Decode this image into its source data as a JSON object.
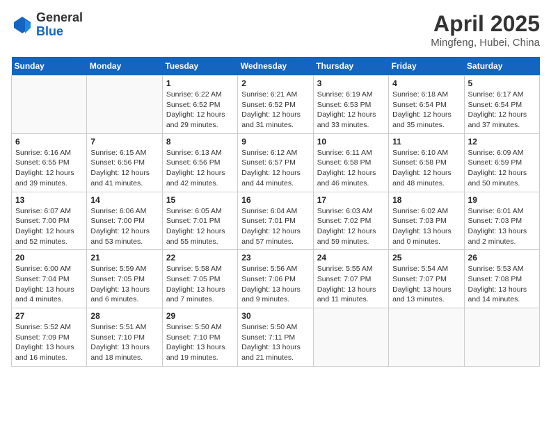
{
  "header": {
    "logo": {
      "line1": "General",
      "line2": "Blue"
    },
    "title": "April 2025",
    "subtitle": "Mingfeng, Hubei, China"
  },
  "weekdays": [
    "Sunday",
    "Monday",
    "Tuesday",
    "Wednesday",
    "Thursday",
    "Friday",
    "Saturday"
  ],
  "weeks": [
    [
      {
        "day": null
      },
      {
        "day": null
      },
      {
        "day": "1",
        "sunrise": "Sunrise: 6:22 AM",
        "sunset": "Sunset: 6:52 PM",
        "daylight": "Daylight: 12 hours and 29 minutes."
      },
      {
        "day": "2",
        "sunrise": "Sunrise: 6:21 AM",
        "sunset": "Sunset: 6:52 PM",
        "daylight": "Daylight: 12 hours and 31 minutes."
      },
      {
        "day": "3",
        "sunrise": "Sunrise: 6:19 AM",
        "sunset": "Sunset: 6:53 PM",
        "daylight": "Daylight: 12 hours and 33 minutes."
      },
      {
        "day": "4",
        "sunrise": "Sunrise: 6:18 AM",
        "sunset": "Sunset: 6:54 PM",
        "daylight": "Daylight: 12 hours and 35 minutes."
      },
      {
        "day": "5",
        "sunrise": "Sunrise: 6:17 AM",
        "sunset": "Sunset: 6:54 PM",
        "daylight": "Daylight: 12 hours and 37 minutes."
      }
    ],
    [
      {
        "day": "6",
        "sunrise": "Sunrise: 6:16 AM",
        "sunset": "Sunset: 6:55 PM",
        "daylight": "Daylight: 12 hours and 39 minutes."
      },
      {
        "day": "7",
        "sunrise": "Sunrise: 6:15 AM",
        "sunset": "Sunset: 6:56 PM",
        "daylight": "Daylight: 12 hours and 41 minutes."
      },
      {
        "day": "8",
        "sunrise": "Sunrise: 6:13 AM",
        "sunset": "Sunset: 6:56 PM",
        "daylight": "Daylight: 12 hours and 42 minutes."
      },
      {
        "day": "9",
        "sunrise": "Sunrise: 6:12 AM",
        "sunset": "Sunset: 6:57 PM",
        "daylight": "Daylight: 12 hours and 44 minutes."
      },
      {
        "day": "10",
        "sunrise": "Sunrise: 6:11 AM",
        "sunset": "Sunset: 6:58 PM",
        "daylight": "Daylight: 12 hours and 46 minutes."
      },
      {
        "day": "11",
        "sunrise": "Sunrise: 6:10 AM",
        "sunset": "Sunset: 6:58 PM",
        "daylight": "Daylight: 12 hours and 48 minutes."
      },
      {
        "day": "12",
        "sunrise": "Sunrise: 6:09 AM",
        "sunset": "Sunset: 6:59 PM",
        "daylight": "Daylight: 12 hours and 50 minutes."
      }
    ],
    [
      {
        "day": "13",
        "sunrise": "Sunrise: 6:07 AM",
        "sunset": "Sunset: 7:00 PM",
        "daylight": "Daylight: 12 hours and 52 minutes."
      },
      {
        "day": "14",
        "sunrise": "Sunrise: 6:06 AM",
        "sunset": "Sunset: 7:00 PM",
        "daylight": "Daylight: 12 hours and 53 minutes."
      },
      {
        "day": "15",
        "sunrise": "Sunrise: 6:05 AM",
        "sunset": "Sunset: 7:01 PM",
        "daylight": "Daylight: 12 hours and 55 minutes."
      },
      {
        "day": "16",
        "sunrise": "Sunrise: 6:04 AM",
        "sunset": "Sunset: 7:01 PM",
        "daylight": "Daylight: 12 hours and 57 minutes."
      },
      {
        "day": "17",
        "sunrise": "Sunrise: 6:03 AM",
        "sunset": "Sunset: 7:02 PM",
        "daylight": "Daylight: 12 hours and 59 minutes."
      },
      {
        "day": "18",
        "sunrise": "Sunrise: 6:02 AM",
        "sunset": "Sunset: 7:03 PM",
        "daylight": "Daylight: 13 hours and 0 minutes."
      },
      {
        "day": "19",
        "sunrise": "Sunrise: 6:01 AM",
        "sunset": "Sunset: 7:03 PM",
        "daylight": "Daylight: 13 hours and 2 minutes."
      }
    ],
    [
      {
        "day": "20",
        "sunrise": "Sunrise: 6:00 AM",
        "sunset": "Sunset: 7:04 PM",
        "daylight": "Daylight: 13 hours and 4 minutes."
      },
      {
        "day": "21",
        "sunrise": "Sunrise: 5:59 AM",
        "sunset": "Sunset: 7:05 PM",
        "daylight": "Daylight: 13 hours and 6 minutes."
      },
      {
        "day": "22",
        "sunrise": "Sunrise: 5:58 AM",
        "sunset": "Sunset: 7:05 PM",
        "daylight": "Daylight: 13 hours and 7 minutes."
      },
      {
        "day": "23",
        "sunrise": "Sunrise: 5:56 AM",
        "sunset": "Sunset: 7:06 PM",
        "daylight": "Daylight: 13 hours and 9 minutes."
      },
      {
        "day": "24",
        "sunrise": "Sunrise: 5:55 AM",
        "sunset": "Sunset: 7:07 PM",
        "daylight": "Daylight: 13 hours and 11 minutes."
      },
      {
        "day": "25",
        "sunrise": "Sunrise: 5:54 AM",
        "sunset": "Sunset: 7:07 PM",
        "daylight": "Daylight: 13 hours and 13 minutes."
      },
      {
        "day": "26",
        "sunrise": "Sunrise: 5:53 AM",
        "sunset": "Sunset: 7:08 PM",
        "daylight": "Daylight: 13 hours and 14 minutes."
      }
    ],
    [
      {
        "day": "27",
        "sunrise": "Sunrise: 5:52 AM",
        "sunset": "Sunset: 7:09 PM",
        "daylight": "Daylight: 13 hours and 16 minutes."
      },
      {
        "day": "28",
        "sunrise": "Sunrise: 5:51 AM",
        "sunset": "Sunset: 7:10 PM",
        "daylight": "Daylight: 13 hours and 18 minutes."
      },
      {
        "day": "29",
        "sunrise": "Sunrise: 5:50 AM",
        "sunset": "Sunset: 7:10 PM",
        "daylight": "Daylight: 13 hours and 19 minutes."
      },
      {
        "day": "30",
        "sunrise": "Sunrise: 5:50 AM",
        "sunset": "Sunset: 7:11 PM",
        "daylight": "Daylight: 13 hours and 21 minutes."
      },
      {
        "day": null
      },
      {
        "day": null
      },
      {
        "day": null
      }
    ]
  ]
}
